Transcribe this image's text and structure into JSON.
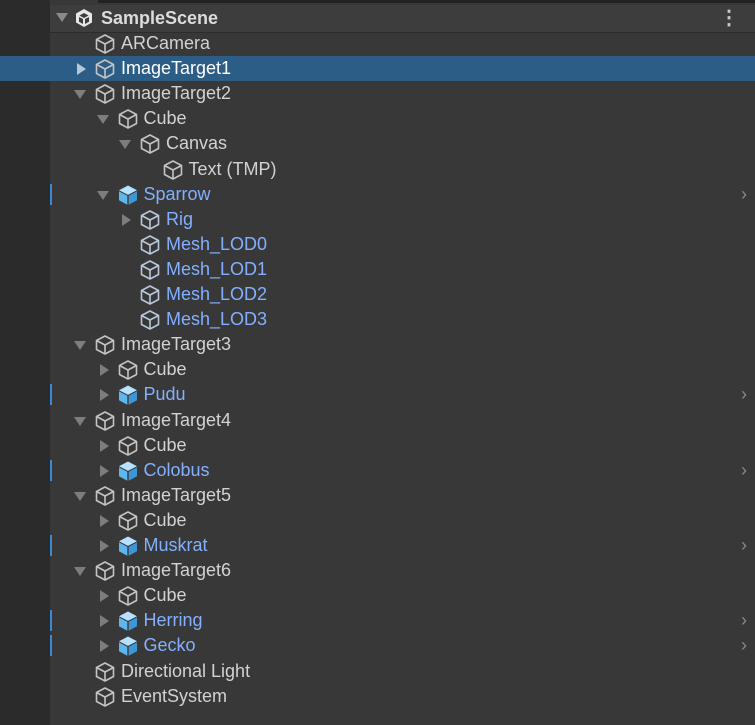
{
  "scene": {
    "title": "SampleScene",
    "menu_glyph": "⋮",
    "icon": "unity-scene-icon"
  },
  "colors": {
    "background": "#383838",
    "gutter": "#2b2b2b",
    "selected_row": "#2c5d87",
    "prefab_text": "#82b0ff",
    "normal_text": "#d2d2d2",
    "prefab_indicator": "#3c8ad6"
  },
  "nav_chevron": "›",
  "hierarchy": [
    {
      "label": "ARCamera",
      "depth": 0,
      "arrow": "none",
      "kind": "gameobject",
      "selected": false,
      "nav": false
    },
    {
      "label": "ImageTarget1",
      "depth": 0,
      "arrow": "collapsed",
      "kind": "gameobject",
      "selected": true,
      "nav": false
    },
    {
      "label": "ImageTarget2",
      "depth": 0,
      "arrow": "expanded",
      "kind": "gameobject",
      "selected": false,
      "nav": false
    },
    {
      "label": "Cube",
      "depth": 1,
      "arrow": "expanded",
      "kind": "gameobject",
      "selected": false,
      "nav": false
    },
    {
      "label": "Canvas",
      "depth": 2,
      "arrow": "expanded",
      "kind": "gameobject",
      "selected": false,
      "nav": false
    },
    {
      "label": "Text (TMP)",
      "depth": 3,
      "arrow": "none",
      "kind": "gameobject",
      "selected": false,
      "nav": false
    },
    {
      "label": "Sparrow",
      "depth": 1,
      "arrow": "expanded",
      "kind": "prefab-root",
      "selected": false,
      "nav": true
    },
    {
      "label": "Rig",
      "depth": 2,
      "arrow": "collapsed",
      "kind": "prefab-child",
      "selected": false,
      "nav": false
    },
    {
      "label": "Mesh_LOD0",
      "depth": 2,
      "arrow": "none",
      "kind": "prefab-child",
      "selected": false,
      "nav": false
    },
    {
      "label": "Mesh_LOD1",
      "depth": 2,
      "arrow": "none",
      "kind": "prefab-child",
      "selected": false,
      "nav": false
    },
    {
      "label": "Mesh_LOD2",
      "depth": 2,
      "arrow": "none",
      "kind": "prefab-child",
      "selected": false,
      "nav": false
    },
    {
      "label": "Mesh_LOD3",
      "depth": 2,
      "arrow": "none",
      "kind": "prefab-child",
      "selected": false,
      "nav": false
    },
    {
      "label": "ImageTarget3",
      "depth": 0,
      "arrow": "expanded",
      "kind": "gameobject",
      "selected": false,
      "nav": false
    },
    {
      "label": "Cube",
      "depth": 1,
      "arrow": "collapsed",
      "kind": "gameobject",
      "selected": false,
      "nav": false
    },
    {
      "label": "Pudu",
      "depth": 1,
      "arrow": "collapsed",
      "kind": "prefab-root",
      "selected": false,
      "nav": true
    },
    {
      "label": "ImageTarget4",
      "depth": 0,
      "arrow": "expanded",
      "kind": "gameobject",
      "selected": false,
      "nav": false
    },
    {
      "label": "Cube",
      "depth": 1,
      "arrow": "collapsed",
      "kind": "gameobject",
      "selected": false,
      "nav": false
    },
    {
      "label": "Colobus",
      "depth": 1,
      "arrow": "collapsed",
      "kind": "prefab-root",
      "selected": false,
      "nav": true
    },
    {
      "label": "ImageTarget5",
      "depth": 0,
      "arrow": "expanded",
      "kind": "gameobject",
      "selected": false,
      "nav": false
    },
    {
      "label": "Cube",
      "depth": 1,
      "arrow": "collapsed",
      "kind": "gameobject",
      "selected": false,
      "nav": false
    },
    {
      "label": "Muskrat",
      "depth": 1,
      "arrow": "collapsed",
      "kind": "prefab-root",
      "selected": false,
      "nav": true
    },
    {
      "label": "ImageTarget6",
      "depth": 0,
      "arrow": "expanded",
      "kind": "gameobject",
      "selected": false,
      "nav": false
    },
    {
      "label": "Cube",
      "depth": 1,
      "arrow": "collapsed",
      "kind": "gameobject",
      "selected": false,
      "nav": false
    },
    {
      "label": "Herring",
      "depth": 1,
      "arrow": "collapsed",
      "kind": "prefab-root",
      "selected": false,
      "nav": true
    },
    {
      "label": "Gecko",
      "depth": 1,
      "arrow": "collapsed",
      "kind": "prefab-root",
      "selected": false,
      "nav": true
    },
    {
      "label": "Directional Light",
      "depth": 0,
      "arrow": "none",
      "kind": "gameobject",
      "selected": false,
      "nav": false
    },
    {
      "label": "EventSystem",
      "depth": 0,
      "arrow": "none",
      "kind": "gameobject",
      "selected": false,
      "nav": false
    }
  ]
}
